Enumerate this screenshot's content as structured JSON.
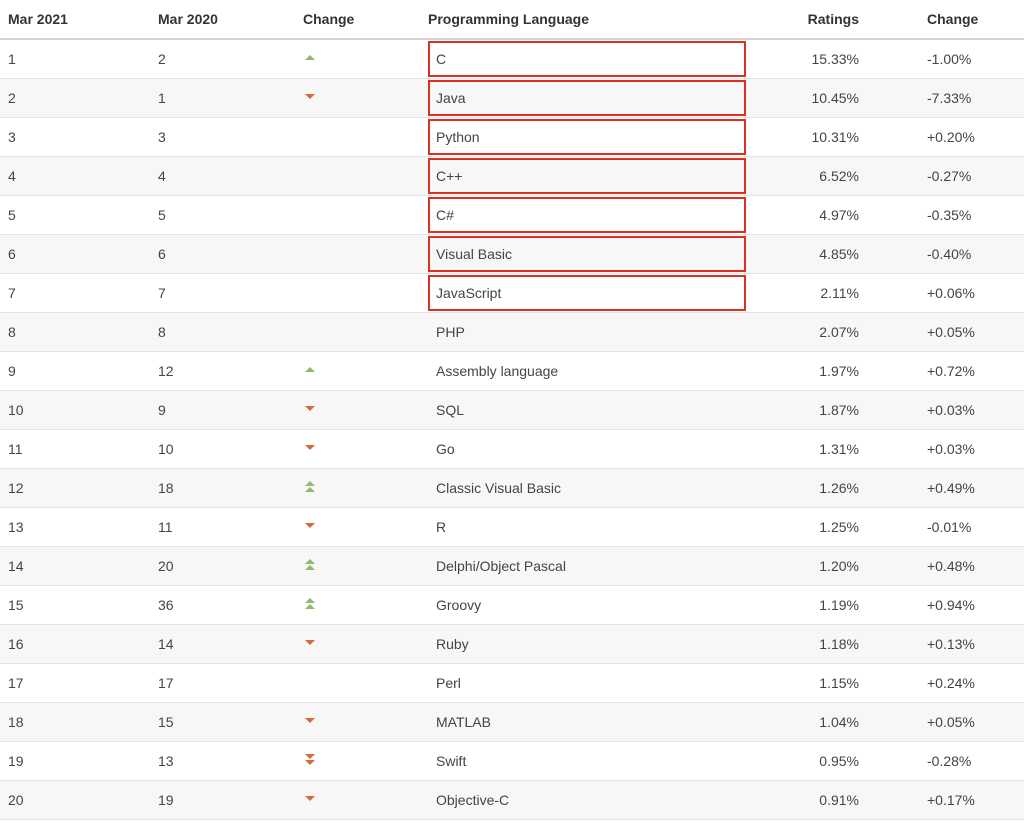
{
  "columns": {
    "rank_now": "Mar 2021",
    "rank_prev": "Mar 2020",
    "rank_change": "Change",
    "language": "Programming Language",
    "ratings": "Ratings",
    "pct_change": "Change"
  },
  "rows": [
    {
      "rank_now": "1",
      "rank_prev": "2",
      "change_icon": "up-single",
      "language": "C",
      "ratings": "15.33%",
      "pct_change": "-1.00%",
      "highlight": true
    },
    {
      "rank_now": "2",
      "rank_prev": "1",
      "change_icon": "down-single",
      "language": "Java",
      "ratings": "10.45%",
      "pct_change": "-7.33%",
      "highlight": true
    },
    {
      "rank_now": "3",
      "rank_prev": "3",
      "change_icon": "",
      "language": "Python",
      "ratings": "10.31%",
      "pct_change": "+0.20%",
      "highlight": true
    },
    {
      "rank_now": "4",
      "rank_prev": "4",
      "change_icon": "",
      "language": "C++",
      "ratings": "6.52%",
      "pct_change": "-0.27%",
      "highlight": true
    },
    {
      "rank_now": "5",
      "rank_prev": "5",
      "change_icon": "",
      "language": "C#",
      "ratings": "4.97%",
      "pct_change": "-0.35%",
      "highlight": true
    },
    {
      "rank_now": "6",
      "rank_prev": "6",
      "change_icon": "",
      "language": "Visual Basic",
      "ratings": "4.85%",
      "pct_change": "-0.40%",
      "highlight": true
    },
    {
      "rank_now": "7",
      "rank_prev": "7",
      "change_icon": "",
      "language": "JavaScript",
      "ratings": "2.11%",
      "pct_change": "+0.06%",
      "highlight": true
    },
    {
      "rank_now": "8",
      "rank_prev": "8",
      "change_icon": "",
      "language": "PHP",
      "ratings": "2.07%",
      "pct_change": "+0.05%",
      "highlight": false
    },
    {
      "rank_now": "9",
      "rank_prev": "12",
      "change_icon": "up-single",
      "language": "Assembly language",
      "ratings": "1.97%",
      "pct_change": "+0.72%",
      "highlight": false
    },
    {
      "rank_now": "10",
      "rank_prev": "9",
      "change_icon": "down-single",
      "language": "SQL",
      "ratings": "1.87%",
      "pct_change": "+0.03%",
      "highlight": false
    },
    {
      "rank_now": "11",
      "rank_prev": "10",
      "change_icon": "down-single",
      "language": "Go",
      "ratings": "1.31%",
      "pct_change": "+0.03%",
      "highlight": false
    },
    {
      "rank_now": "12",
      "rank_prev": "18",
      "change_icon": "up-double",
      "language": "Classic Visual Basic",
      "ratings": "1.26%",
      "pct_change": "+0.49%",
      "highlight": false
    },
    {
      "rank_now": "13",
      "rank_prev": "11",
      "change_icon": "down-single",
      "language": "R",
      "ratings": "1.25%",
      "pct_change": "-0.01%",
      "highlight": false
    },
    {
      "rank_now": "14",
      "rank_prev": "20",
      "change_icon": "up-double",
      "language": "Delphi/Object Pascal",
      "ratings": "1.20%",
      "pct_change": "+0.48%",
      "highlight": false
    },
    {
      "rank_now": "15",
      "rank_prev": "36",
      "change_icon": "up-double",
      "language": "Groovy",
      "ratings": "1.19%",
      "pct_change": "+0.94%",
      "highlight": false
    },
    {
      "rank_now": "16",
      "rank_prev": "14",
      "change_icon": "down-single",
      "language": "Ruby",
      "ratings": "1.18%",
      "pct_change": "+0.13%",
      "highlight": false
    },
    {
      "rank_now": "17",
      "rank_prev": "17",
      "change_icon": "",
      "language": "Perl",
      "ratings": "1.15%",
      "pct_change": "+0.24%",
      "highlight": false
    },
    {
      "rank_now": "18",
      "rank_prev": "15",
      "change_icon": "down-single",
      "language": "MATLAB",
      "ratings": "1.04%",
      "pct_change": "+0.05%",
      "highlight": false
    },
    {
      "rank_now": "19",
      "rank_prev": "13",
      "change_icon": "down-double",
      "language": "Swift",
      "ratings": "0.95%",
      "pct_change": "-0.28%",
      "highlight": false
    },
    {
      "rank_now": "20",
      "rank_prev": "19",
      "change_icon": "down-single",
      "language": "Objective-C",
      "ratings": "0.91%",
      "pct_change": "+0.17%",
      "highlight": false
    }
  ]
}
